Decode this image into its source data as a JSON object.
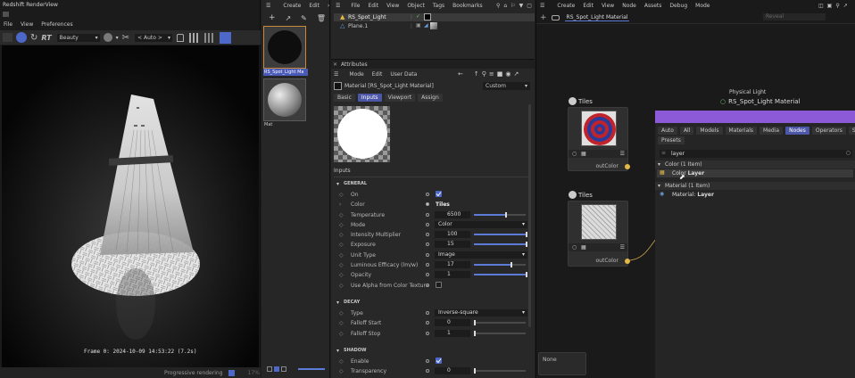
{
  "render_view": {
    "title": "Redshift RenderView",
    "menu": [
      "File",
      "View",
      "Preferences"
    ],
    "aov": "Beauty",
    "auto": "< Auto >",
    "rt": "RT",
    "frame_info": "Frame 0: 2024-10-09 14:53:22 (7.2s)",
    "status": "Progressive rendering",
    "percent": "17%"
  },
  "material_manager": {
    "menu": [
      "Create",
      "Edit"
    ],
    "materials": [
      {
        "name": "RS_Spot_Light Ma"
      },
      {
        "name": "Mat"
      }
    ]
  },
  "object_manager": {
    "menu": [
      "File",
      "Edit",
      "View",
      "Object",
      "Tags",
      "Bookmarks"
    ],
    "objects": [
      {
        "name": "RS_Spot_Light"
      },
      {
        "name": "Plane.1"
      }
    ]
  },
  "attributes": {
    "title": "Attributes",
    "menu": [
      "Mode",
      "Edit",
      "User Data"
    ],
    "material_label": "Material [RS_Spot_Light Material]",
    "preset": "Custom",
    "tabs": [
      {
        "label": "Basic",
        "active": false
      },
      {
        "label": "Inputs",
        "active": true
      },
      {
        "label": "Viewport",
        "active": false
      },
      {
        "label": "Assign",
        "active": false
      }
    ],
    "inputs_heading": "Inputs",
    "general": {
      "title": "GENERAL",
      "rows": [
        {
          "label": "On",
          "kind": "check",
          "checked": true
        },
        {
          "label": "Color",
          "kind": "link",
          "value": "Tiles"
        },
        {
          "label": "Temperature",
          "kind": "num",
          "value": "6500",
          "level": 0.6
        },
        {
          "label": "Mode",
          "kind": "drop",
          "value": "Color"
        },
        {
          "label": "Intensity Multiplier",
          "kind": "num",
          "value": "100",
          "level": 1.0
        },
        {
          "label": "Exposure",
          "kind": "num",
          "value": "15",
          "level": 1.0
        },
        {
          "label": "Unit Type",
          "kind": "drop",
          "value": "Image"
        },
        {
          "label": "Luminous Efficacy (lm/w)",
          "kind": "num",
          "value": "17",
          "level": 0.7
        },
        {
          "label": "Opacity",
          "kind": "num",
          "value": "1",
          "level": 1.0
        },
        {
          "label": "Use Alpha from Color Texture",
          "kind": "check",
          "checked": false
        }
      ]
    },
    "decay": {
      "title": "DECAY",
      "rows": [
        {
          "label": "Type",
          "kind": "drop",
          "value": "Inverse-square"
        },
        {
          "label": "Falloff Start",
          "kind": "num",
          "value": "0",
          "level": 0.0
        },
        {
          "label": "Falloff Stop",
          "kind": "num",
          "value": "1",
          "level": 0.0
        }
      ]
    },
    "shadow": {
      "title": "SHADOW",
      "rows": [
        {
          "label": "Enable",
          "kind": "check",
          "checked": true
        },
        {
          "label": "Transparency",
          "kind": "num",
          "value": "0",
          "level": 0.0
        }
      ]
    }
  },
  "node_editor": {
    "menu": [
      "Create",
      "Edit",
      "View",
      "Node",
      "Assets",
      "Debug",
      "Mode"
    ],
    "tab": "RS_Spot_Light Material",
    "search_placeholder": "Reveal",
    "physical_light_label": "Physical Light",
    "material_node_label": "RS_Spot_Light Material",
    "nodes": [
      {
        "title": "Tiles",
        "port": "outColor",
        "variant": "target"
      },
      {
        "title": "Tiles",
        "port": "outColor",
        "variant": "weave"
      }
    ],
    "none_label": "None",
    "popup": {
      "tabs": [
        {
          "label": "Auto",
          "active": false
        },
        {
          "label": "All",
          "active": false
        },
        {
          "label": "Models",
          "active": false
        },
        {
          "label": "Materials",
          "active": false
        },
        {
          "label": "Media",
          "active": false
        },
        {
          "label": "Nodes",
          "active": true
        },
        {
          "label": "Operators",
          "active": false
        },
        {
          "label": "Scen",
          "active": false
        }
      ],
      "presets": "Presets",
      "search_value": "layer",
      "groups": [
        {
          "title": "Color (1 Item)",
          "item_prefix": "Color ",
          "item_bold": "Layer"
        },
        {
          "title": "Material (1 Item)",
          "item_prefix": "Material: ",
          "item_bold": "Layer"
        }
      ]
    }
  },
  "colors": {
    "accent": "#5b6fd6",
    "popup_header": "#8c5ad6",
    "port": "#e3b84a"
  }
}
